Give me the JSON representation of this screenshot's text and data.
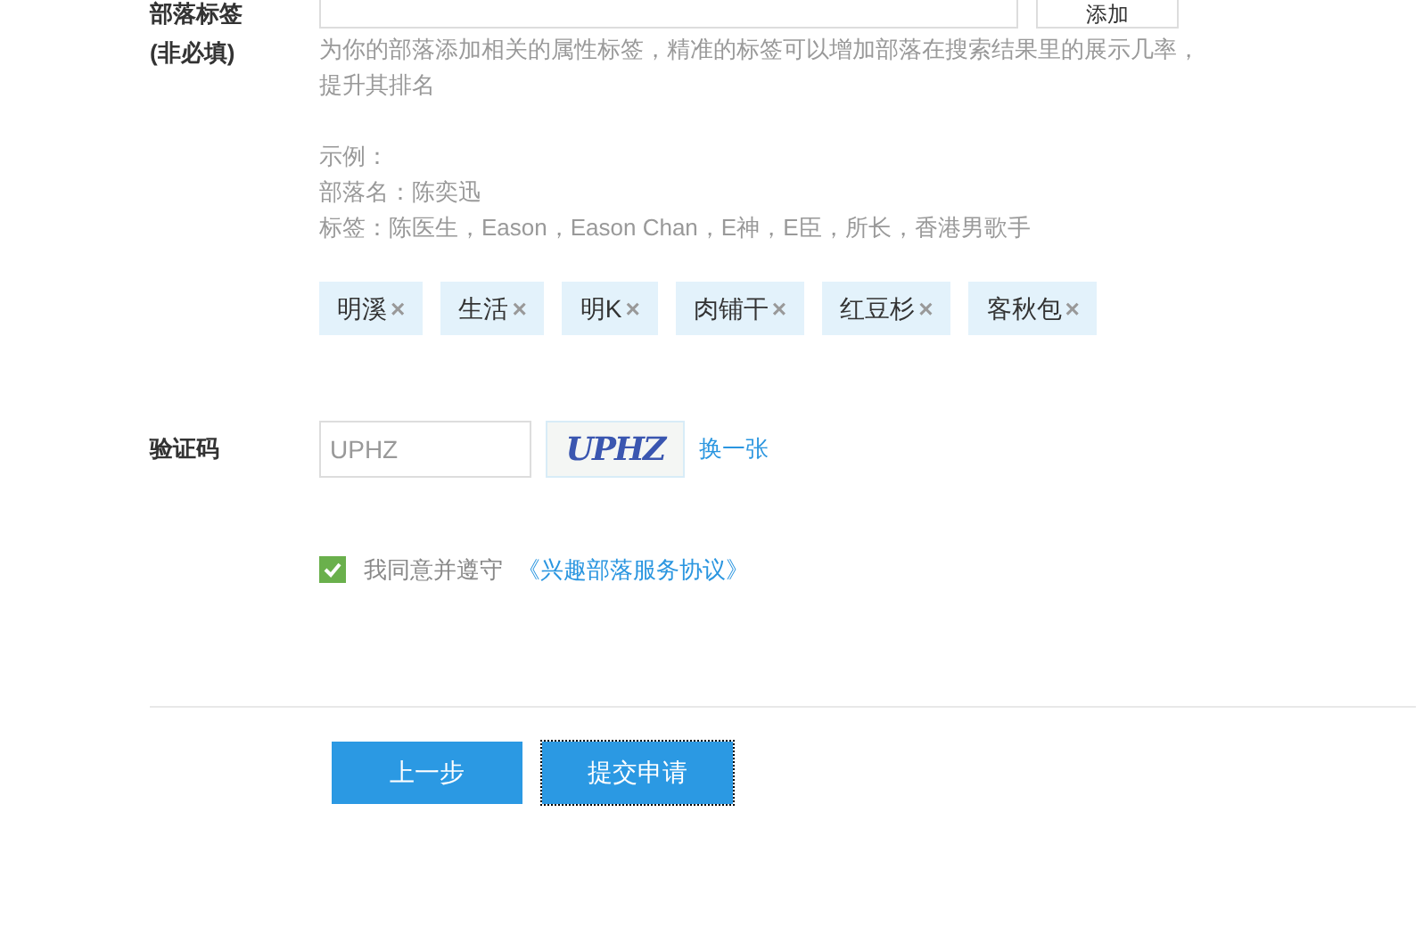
{
  "tags_field": {
    "label": "部落标签",
    "button": "添加"
  },
  "optional_note": "(非必填)",
  "description": "为你的部落添加相关的属性标签，精准的标签可以增加部落在搜索结果里的展示几率，提升其排名",
  "example_lines": [
    "示例：",
    "部落名：陈奕迅",
    "标签：陈医生，Eason，Eason Chan，E神，E臣，所长，香港男歌手"
  ],
  "tags": [
    {
      "label": "明溪",
      "remove": "×"
    },
    {
      "label": "生活",
      "remove": "×"
    },
    {
      "label": "明K",
      "remove": "×"
    },
    {
      "label": "肉铺干",
      "remove": "×"
    },
    {
      "label": "红豆杉",
      "remove": "×"
    },
    {
      "label": "客秋包",
      "remove": "×"
    }
  ],
  "captcha": {
    "label": "验证码",
    "value": "UPHZ",
    "image_text": "UPHZ",
    "refresh": "换一张"
  },
  "agreement": {
    "checked": true,
    "text": "我同意并遵守",
    "link": "《兴趣部落服务协议》"
  },
  "buttons": [
    {
      "label": "上一步",
      "focused": false
    },
    {
      "label": "提交申请",
      "focused": true
    }
  ]
}
